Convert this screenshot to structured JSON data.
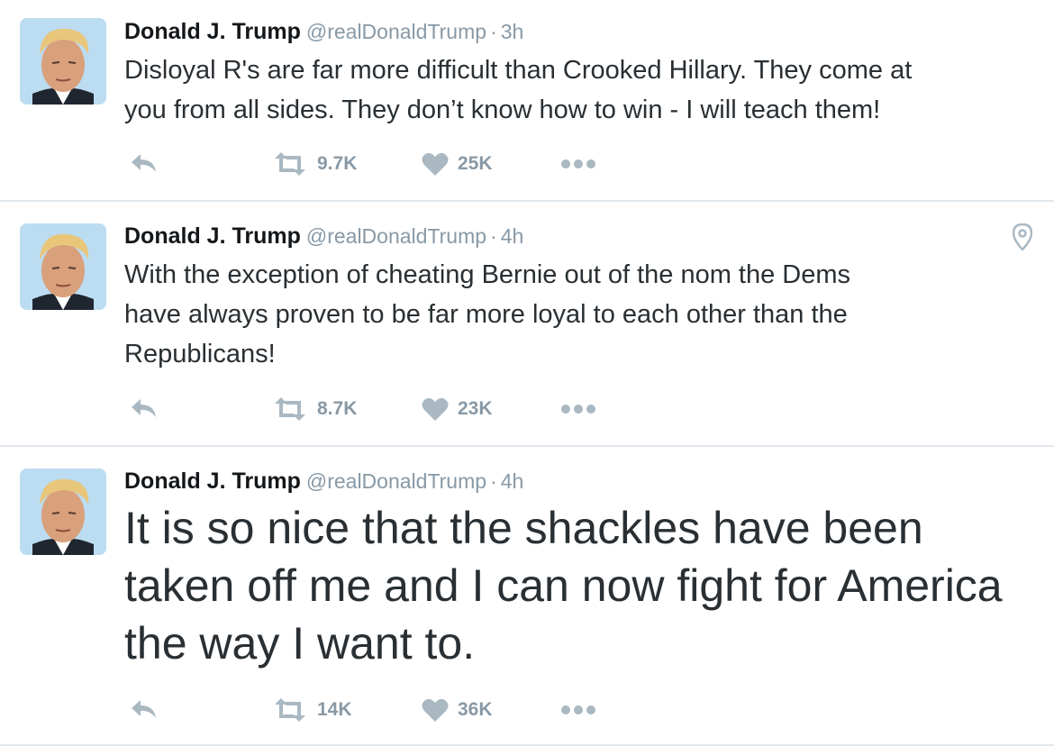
{
  "tweets": [
    {
      "name": "Donald J. Trump",
      "handle": "@realDonaldTrump",
      "separator": "·",
      "time": "3h",
      "text": "Disloyal R's are far more difficult than Crooked Hillary. They come at\nyou from all sides. They don’t know how to win - I will teach them!",
      "retweets": "9.7K",
      "likes": "25K"
    },
    {
      "name": "Donald J. Trump",
      "handle": "@realDonaldTrump",
      "separator": "·",
      "time": "4h",
      "text": "With the exception of cheating Bernie out of the nom the Dems\nhave always proven to be far more loyal to each other than the\nRepublicans!",
      "retweets": "8.7K",
      "likes": "23K"
    },
    {
      "name": "Donald J. Trump",
      "handle": "@realDonaldTrump",
      "separator": "·",
      "time": "4h",
      "text": "It is so nice that the shackles have been\ntaken off me and I can now fight for America\nthe way I want to.",
      "retweets": "14K",
      "likes": "36K"
    }
  ],
  "icons": {
    "reply": "reply-icon",
    "retweet": "retweet-icon",
    "like": "heart-icon",
    "more": "more-icon",
    "location": "location-pin-icon"
  },
  "colors": {
    "text": "#292f33",
    "name": "#14171a",
    "muted": "#8899a6",
    "icon": "#aab8c2",
    "divider": "#e1e8ed"
  }
}
